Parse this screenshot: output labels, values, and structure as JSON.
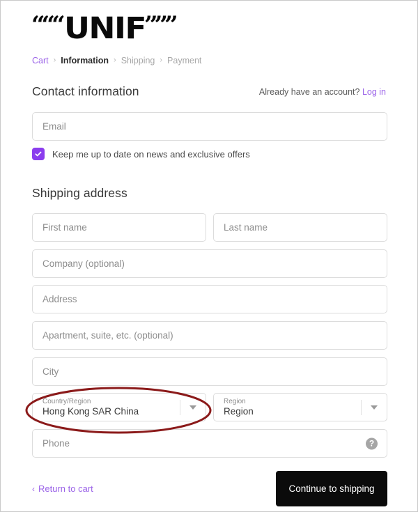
{
  "brand": {
    "name": "UNIF",
    "quote_left": "“““",
    "quote_right": "”””"
  },
  "breadcrumb": {
    "items": [
      {
        "label": "Cart",
        "state": "link"
      },
      {
        "label": "Information",
        "state": "current"
      },
      {
        "label": "Shipping",
        "state": "muted"
      },
      {
        "label": "Payment",
        "state": "muted"
      }
    ],
    "separator": "›"
  },
  "contact": {
    "heading": "Contact information",
    "account_prompt": "Already have an account?",
    "login_label": "Log in",
    "email_placeholder": "Email",
    "email_value": "",
    "newsletter_label": "Keep me up to date on news and exclusive offers",
    "newsletter_checked": true
  },
  "shipping": {
    "heading": "Shipping address",
    "fields": {
      "first_name": {
        "placeholder": "First name",
        "value": ""
      },
      "last_name": {
        "placeholder": "Last name",
        "value": ""
      },
      "company": {
        "placeholder": "Company (optional)",
        "value": ""
      },
      "address": {
        "placeholder": "Address",
        "value": ""
      },
      "apartment": {
        "placeholder": "Apartment, suite, etc. (optional)",
        "value": ""
      },
      "city": {
        "placeholder": "City",
        "value": ""
      },
      "phone": {
        "placeholder": "Phone",
        "value": ""
      }
    },
    "country": {
      "label": "Country/Region",
      "value": "Hong Kong SAR China"
    },
    "region": {
      "label": "Region",
      "value": "Region"
    },
    "phone_help_glyph": "?"
  },
  "footer": {
    "return_chevron": "‹",
    "return_label": "Return to cart",
    "continue_label": "Continue to shipping"
  },
  "colors": {
    "accent_purple": "#9b63e8",
    "checkbox_purple": "#8b3dee",
    "button_black": "#0b0b0b",
    "annotation_red": "#8b1a1a",
    "field_border": "#dcdcdc",
    "placeholder_gray": "#8d8d8d"
  }
}
